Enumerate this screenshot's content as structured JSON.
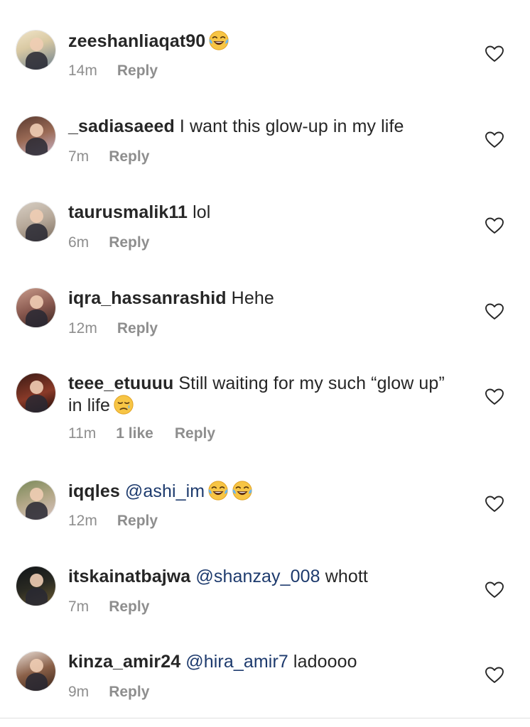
{
  "comments": [
    {
      "username": "zeeshanliaqat90",
      "text": "",
      "mention": "",
      "after": "",
      "emojis": [
        "face-with-tears-of-joy"
      ],
      "time": "14m",
      "likes": "",
      "reply": "Reply"
    },
    {
      "username": "_sadiasaeed",
      "text": " I want this glow-up in my life",
      "mention": "",
      "after": "",
      "emojis": [],
      "time": "7m",
      "likes": "",
      "reply": "Reply"
    },
    {
      "username": "taurusmalik11",
      "text": " lol",
      "mention": "",
      "after": "",
      "emojis": [],
      "time": "6m",
      "likes": "",
      "reply": "Reply"
    },
    {
      "username": "iqra_hassanrashid",
      "text": " Hehe",
      "mention": "",
      "after": "",
      "emojis": [],
      "time": "12m",
      "likes": "",
      "reply": "Reply"
    },
    {
      "username": "teee_etuuuu",
      "text": " Still waiting  for my such “glow up” in life",
      "mention": "",
      "after": "",
      "emojis": [
        "sleepy-face"
      ],
      "time": "11m",
      "likes": "1 like",
      "reply": "Reply"
    },
    {
      "username": "iqqles",
      "text": " ",
      "mention": "@ashi_im",
      "after": "",
      "emojis": [
        "face-with-tears-of-joy",
        "face-with-tears-of-joy"
      ],
      "time": "12m",
      "likes": "",
      "reply": "Reply"
    },
    {
      "username": "itskainatbajwa",
      "text": " ",
      "mention": "@shanzay_008",
      "after": "  whott",
      "emojis": [],
      "time": "7m",
      "likes": "",
      "reply": "Reply"
    },
    {
      "username": "kinza_amir24",
      "text": " ",
      "mention": "@hira_amir7",
      "after": " ladoooo",
      "emojis": [],
      "time": "9m",
      "likes": "",
      "reply": "Reply"
    }
  ],
  "icons": {
    "like": "heart-outline-icon"
  },
  "colors": {
    "text": "#262626",
    "meta": "#8e8e8e",
    "mention": "#1d3a6d"
  }
}
